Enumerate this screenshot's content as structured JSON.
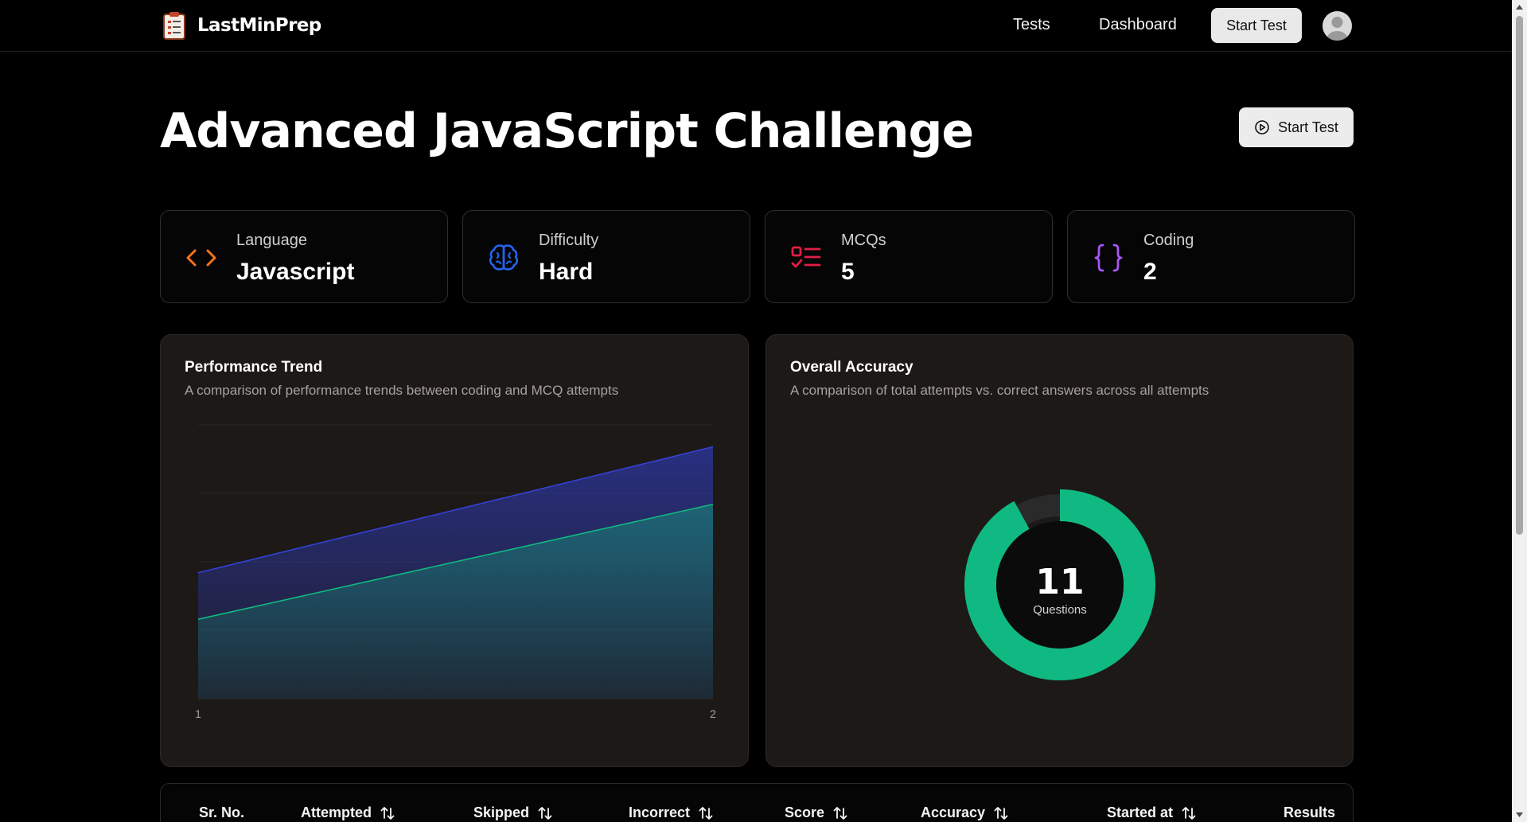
{
  "nav": {
    "brand": "LastMinPrep",
    "links": [
      "Tests",
      "Dashboard"
    ],
    "start_label": "Start Test"
  },
  "header": {
    "title": "Advanced JavaScript Challenge",
    "start_label": "Start Test"
  },
  "stats": [
    {
      "label": "Language",
      "value": "Javascript",
      "icon": "code-icon",
      "color": "#f97316"
    },
    {
      "label": "Difficulty",
      "value": "Hard",
      "icon": "brain-icon",
      "color": "#2563eb"
    },
    {
      "label": "MCQs",
      "value": "5",
      "icon": "list-check-icon",
      "color": "#e11d48"
    },
    {
      "label": "Coding",
      "value": "2",
      "icon": "braces-icon",
      "color": "#a855f7"
    }
  ],
  "trend": {
    "title": "Performance Trend",
    "subtitle": "A comparison of performance trends between coding and MCQ attempts"
  },
  "accuracy": {
    "title": "Overall Accuracy",
    "subtitle": "A comparison of total attempts vs. correct answers across all attempts",
    "center_value": "11",
    "center_label": "Questions"
  },
  "table": {
    "headers": [
      {
        "label": "Sr. No.",
        "sortable": false
      },
      {
        "label": "Attempted",
        "sortable": true
      },
      {
        "label": "Skipped",
        "sortable": true
      },
      {
        "label": "Incorrect",
        "sortable": true
      },
      {
        "label": "Score",
        "sortable": true
      },
      {
        "label": "Accuracy",
        "sortable": true
      },
      {
        "label": "Started at",
        "sortable": true
      },
      {
        "label": "Results",
        "sortable": false
      }
    ]
  },
  "colors": {
    "coding_series": "#3342d6",
    "mcq_series": "#10b981",
    "donut_fill": "#10b981",
    "donut_track": "#2a2a2a"
  },
  "chart_data": [
    {
      "type": "area",
      "x": [
        1,
        2
      ],
      "series": [
        {
          "values": [
            0.46,
            0.92
          ]
        },
        {
          "values": [
            0.29,
            0.71
          ]
        }
      ],
      "ylim": [
        0,
        1
      ],
      "grid": true
    },
    {
      "type": "pie",
      "donut": true,
      "values": [
        0.92,
        0.08
      ]
    }
  ]
}
